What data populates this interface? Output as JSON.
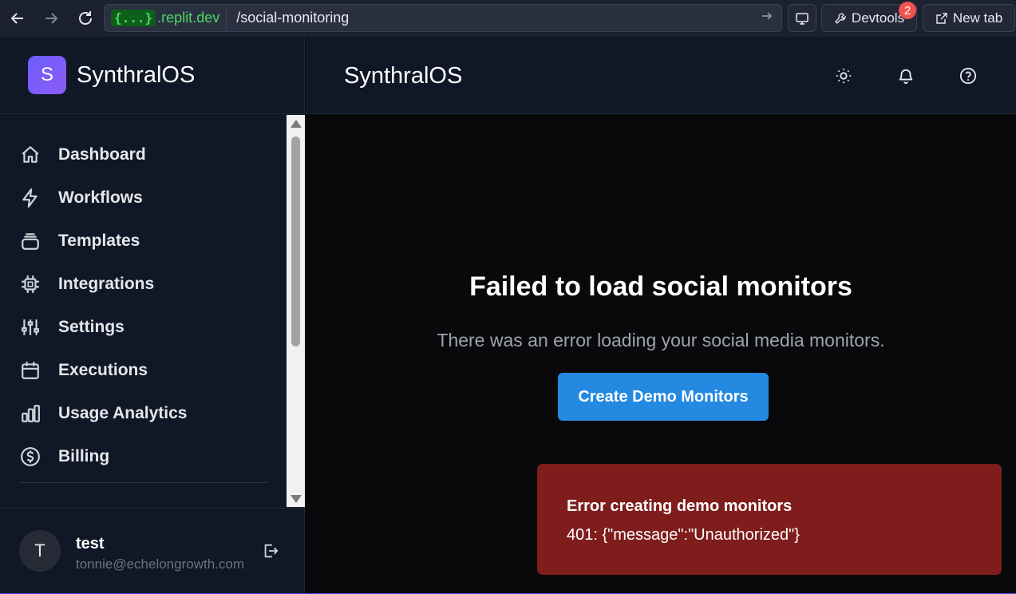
{
  "browser": {
    "host_badge": "{...}",
    "host_domain": ".replit.dev",
    "url_path": "/social-monitoring",
    "devtools_label": "Devtools",
    "devtools_badge": "2",
    "new_tab_label": "New tab"
  },
  "sidebar": {
    "logo_letter": "S",
    "brand": "SynthralOS",
    "items": [
      {
        "label": "Dashboard",
        "icon": "home-icon"
      },
      {
        "label": "Workflows",
        "icon": "lightning-icon"
      },
      {
        "label": "Templates",
        "icon": "stack-icon"
      },
      {
        "label": "Integrations",
        "icon": "chip-icon"
      },
      {
        "label": "Settings",
        "icon": "sliders-icon"
      },
      {
        "label": "Executions",
        "icon": "calendar-icon"
      },
      {
        "label": "Usage Analytics",
        "icon": "bar-chart-icon"
      },
      {
        "label": "Billing",
        "icon": "dollar-icon"
      }
    ],
    "user": {
      "initial": "T",
      "name": "test",
      "email": "tonnie@echelongrowth.com"
    }
  },
  "header": {
    "title": "SynthralOS",
    "icons": [
      "sun-icon",
      "bell-icon",
      "help-icon"
    ]
  },
  "main": {
    "error_title": "Failed to load social monitors",
    "error_message": "There was an error loading your social media monitors.",
    "action_label": "Create Demo Monitors"
  },
  "toast": {
    "title": "Error creating demo monitors",
    "message": "401: {\"message\":\"Unauthorized\"}"
  },
  "colors": {
    "accent_button": "#2389e1",
    "toast_bg": "#7f1d1d",
    "sidebar_bg": "#101827",
    "logo_gradient": "#6d5dfc"
  }
}
